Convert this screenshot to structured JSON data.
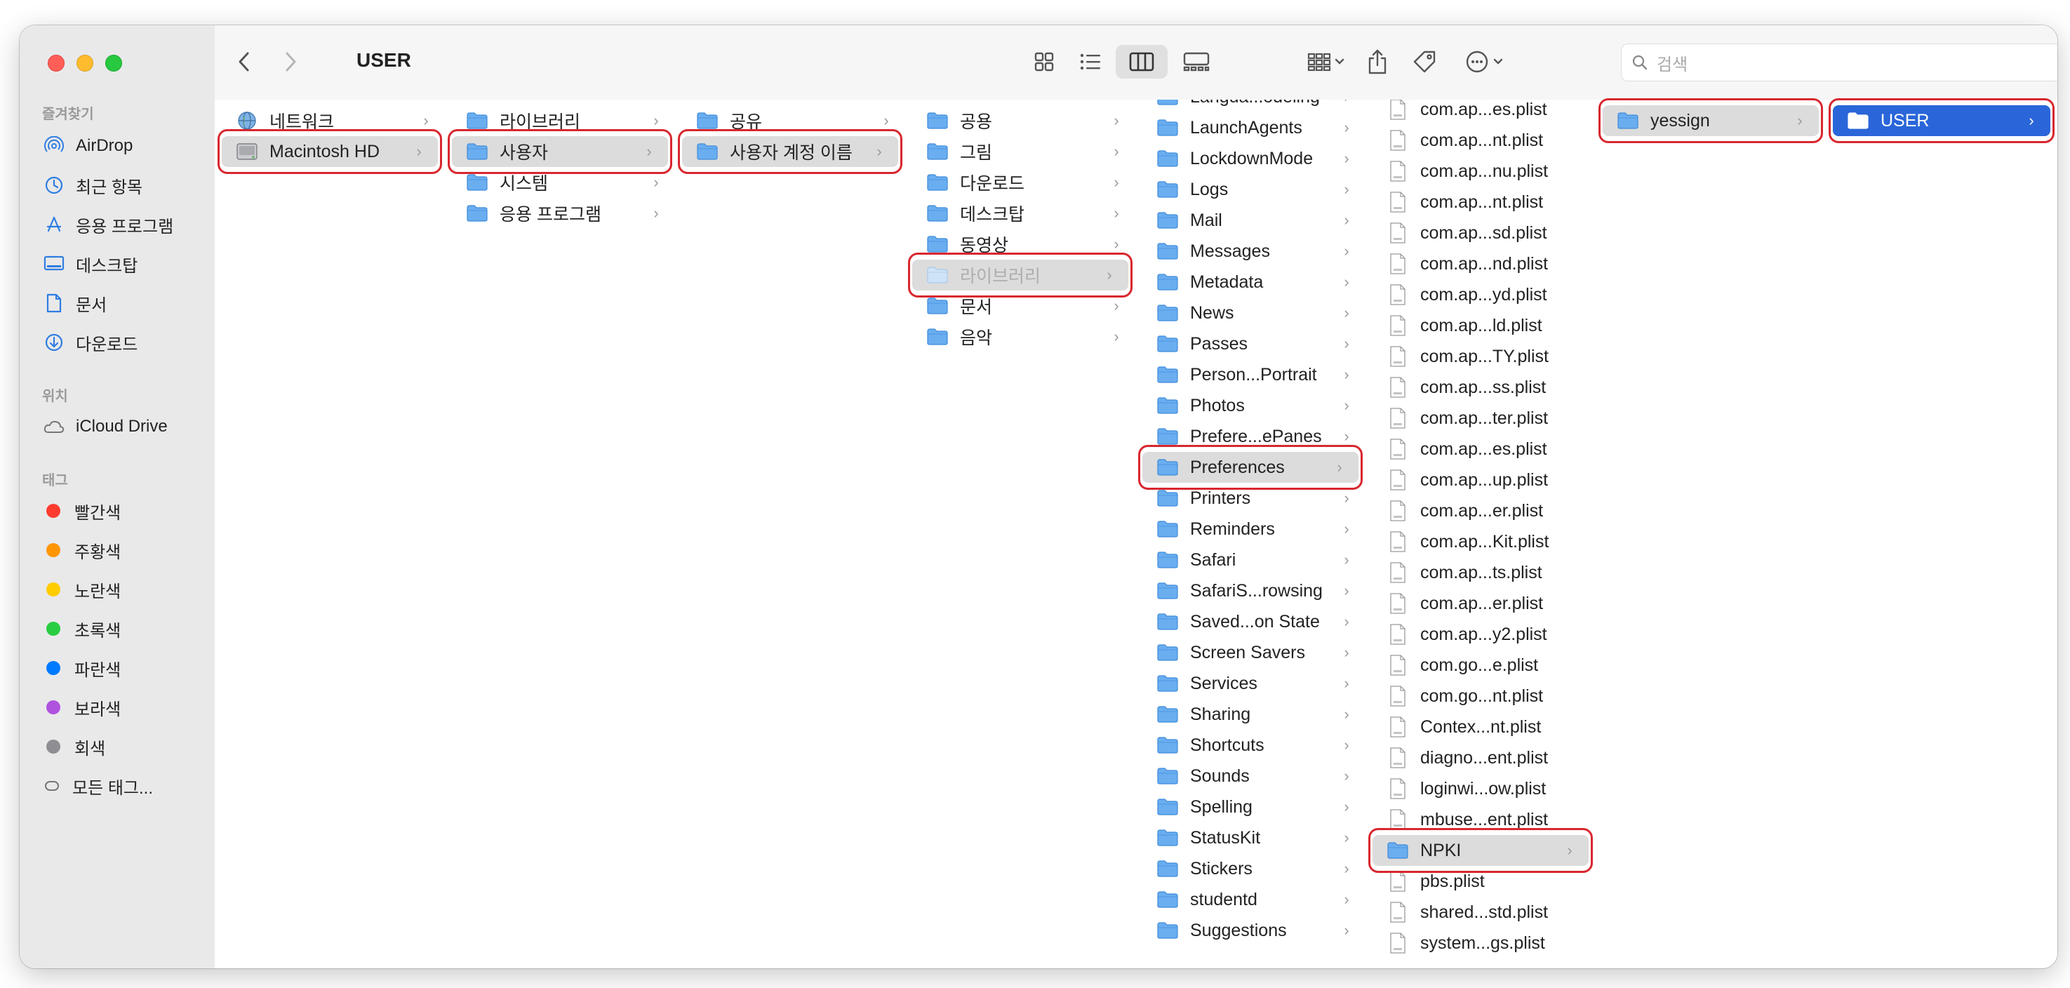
{
  "window": {
    "title": "USER"
  },
  "search": {
    "placeholder": "검색"
  },
  "sidebar": {
    "favorites_header": "즐겨찾기",
    "favorites": [
      {
        "label": "AirDrop",
        "icon": "airdrop-icon"
      },
      {
        "label": "최근 항목",
        "icon": "clock-icon"
      },
      {
        "label": "응용 프로그램",
        "icon": "applications-icon"
      },
      {
        "label": "데스크탑",
        "icon": "desktop-icon"
      },
      {
        "label": "문서",
        "icon": "document-icon"
      },
      {
        "label": "다운로드",
        "icon": "download-icon"
      }
    ],
    "locations_header": "위치",
    "locations": [
      {
        "label": "iCloud Drive",
        "icon": "cloud-icon"
      }
    ],
    "tags_header": "태그",
    "tags": [
      {
        "label": "빨간색",
        "color": "#ff3b30"
      },
      {
        "label": "주황색",
        "color": "#ff9500"
      },
      {
        "label": "노란색",
        "color": "#ffcc00"
      },
      {
        "label": "초록색",
        "color": "#28cd41"
      },
      {
        "label": "파란색",
        "color": "#007aff"
      },
      {
        "label": "보라색",
        "color": "#af52de"
      },
      {
        "label": "회색",
        "color": "#8e8e93"
      },
      {
        "label": "모든 태그...",
        "color": ""
      }
    ]
  },
  "columns": [
    {
      "items": [
        {
          "label": "네트워크",
          "icon": "network-globe-icon"
        },
        {
          "label": "Macintosh HD",
          "icon": "hard-drive-icon",
          "selected": true,
          "highlighted": true
        }
      ]
    },
    {
      "items": [
        {
          "label": "라이브러리",
          "icon": "folder-icon"
        },
        {
          "label": "사용자",
          "icon": "folder-icon",
          "selected": true,
          "highlighted": true
        },
        {
          "label": "시스템",
          "icon": "folder-icon"
        },
        {
          "label": "응용 프로그램",
          "icon": "folder-icon"
        }
      ]
    },
    {
      "items": [
        {
          "label": "공유",
          "icon": "folder-icon"
        },
        {
          "label": "사용자 계정 이름",
          "icon": "folder-icon",
          "selected": true,
          "highlighted": true
        }
      ]
    },
    {
      "items": [
        {
          "label": "공용",
          "icon": "folder-icon"
        },
        {
          "label": "그림",
          "icon": "folder-icon"
        },
        {
          "label": "다운로드",
          "icon": "folder-icon"
        },
        {
          "label": "데스크탑",
          "icon": "folder-icon"
        },
        {
          "label": "동영상",
          "icon": "folder-icon"
        },
        {
          "label": "라이브러리",
          "icon": "folder-icon",
          "selected": true,
          "highlighted": true,
          "dimmed": true
        },
        {
          "label": "문서",
          "icon": "folder-icon"
        },
        {
          "label": "음악",
          "icon": "folder-icon"
        }
      ]
    },
    {
      "items": [
        {
          "label": "Langua...odeling",
          "icon": "folder-icon"
        },
        {
          "label": "LaunchAgents",
          "icon": "folder-icon"
        },
        {
          "label": "LockdownMode",
          "icon": "folder-icon"
        },
        {
          "label": "Logs",
          "icon": "folder-icon"
        },
        {
          "label": "Mail",
          "icon": "folder-icon"
        },
        {
          "label": "Messages",
          "icon": "folder-icon"
        },
        {
          "label": "Metadata",
          "icon": "folder-icon"
        },
        {
          "label": "News",
          "icon": "folder-icon"
        },
        {
          "label": "Passes",
          "icon": "folder-icon"
        },
        {
          "label": "Person...Portrait",
          "icon": "folder-icon"
        },
        {
          "label": "Photos",
          "icon": "folder-icon"
        },
        {
          "label": "Prefere...ePanes",
          "icon": "folder-icon"
        },
        {
          "label": "Preferences",
          "icon": "folder-icon",
          "selected": true,
          "highlighted": true
        },
        {
          "label": "Printers",
          "icon": "folder-icon"
        },
        {
          "label": "Reminders",
          "icon": "folder-icon"
        },
        {
          "label": "Safari",
          "icon": "folder-icon"
        },
        {
          "label": "SafariS...rowsing",
          "icon": "folder-icon"
        },
        {
          "label": "Saved...on State",
          "icon": "folder-icon"
        },
        {
          "label": "Screen Savers",
          "icon": "folder-icon"
        },
        {
          "label": "Services",
          "icon": "folder-icon"
        },
        {
          "label": "Sharing",
          "icon": "folder-icon"
        },
        {
          "label": "Shortcuts",
          "icon": "folder-icon"
        },
        {
          "label": "Sounds",
          "icon": "folder-icon"
        },
        {
          "label": "Spelling",
          "icon": "folder-icon"
        },
        {
          "label": "StatusKit",
          "icon": "folder-icon"
        },
        {
          "label": "Stickers",
          "icon": "folder-icon"
        },
        {
          "label": "studentd",
          "icon": "folder-icon"
        },
        {
          "label": "Suggestions",
          "icon": "folder-icon"
        }
      ]
    },
    {
      "items": [
        {
          "label": "com.ap...es.plist",
          "icon": "plist-file-icon"
        },
        {
          "label": "com.ap...nt.plist",
          "icon": "plist-file-icon"
        },
        {
          "label": "com.ap...nu.plist",
          "icon": "plist-file-icon"
        },
        {
          "label": "com.ap...nt.plist",
          "icon": "plist-file-icon"
        },
        {
          "label": "com.ap...sd.plist",
          "icon": "plist-file-icon"
        },
        {
          "label": "com.ap...nd.plist",
          "icon": "plist-file-icon"
        },
        {
          "label": "com.ap...yd.plist",
          "icon": "plist-file-icon"
        },
        {
          "label": "com.ap...ld.plist",
          "icon": "plist-file-icon"
        },
        {
          "label": "com.ap...TY.plist",
          "icon": "plist-file-icon"
        },
        {
          "label": "com.ap...ss.plist",
          "icon": "plist-file-icon"
        },
        {
          "label": "com.ap...ter.plist",
          "icon": "plist-file-icon"
        },
        {
          "label": "com.ap...es.plist",
          "icon": "plist-file-icon"
        },
        {
          "label": "com.ap...up.plist",
          "icon": "plist-file-icon"
        },
        {
          "label": "com.ap...er.plist",
          "icon": "plist-file-icon"
        },
        {
          "label": "com.ap...Kit.plist",
          "icon": "plist-file-icon"
        },
        {
          "label": "com.ap...ts.plist",
          "icon": "plist-file-icon"
        },
        {
          "label": "com.ap...er.plist",
          "icon": "plist-file-icon"
        },
        {
          "label": "com.ap...y2.plist",
          "icon": "plist-file-icon"
        },
        {
          "label": "com.go...e.plist",
          "icon": "plist-file-icon"
        },
        {
          "label": "com.go...nt.plist",
          "icon": "plist-file-icon"
        },
        {
          "label": "Contex...nt.plist",
          "icon": "plist-file-icon"
        },
        {
          "label": "diagno...ent.plist",
          "icon": "plist-file-icon"
        },
        {
          "label": "loginwi...ow.plist",
          "icon": "plist-file-icon"
        },
        {
          "label": "mbuse...ent.plist",
          "icon": "plist-file-icon"
        },
        {
          "label": "NPKI",
          "icon": "folder-icon",
          "selected": true,
          "highlighted": true
        },
        {
          "label": "pbs.plist",
          "icon": "plist-file-icon"
        },
        {
          "label": "shared...std.plist",
          "icon": "plist-file-icon"
        },
        {
          "label": "system...gs.plist",
          "icon": "plist-file-icon"
        }
      ]
    },
    {
      "items": [
        {
          "label": "yessign",
          "icon": "folder-icon",
          "selected": true,
          "highlighted": true
        }
      ]
    },
    {
      "items": [
        {
          "label": "USER",
          "icon": "folder-icon",
          "active": true,
          "highlighted": true
        }
      ]
    }
  ]
}
